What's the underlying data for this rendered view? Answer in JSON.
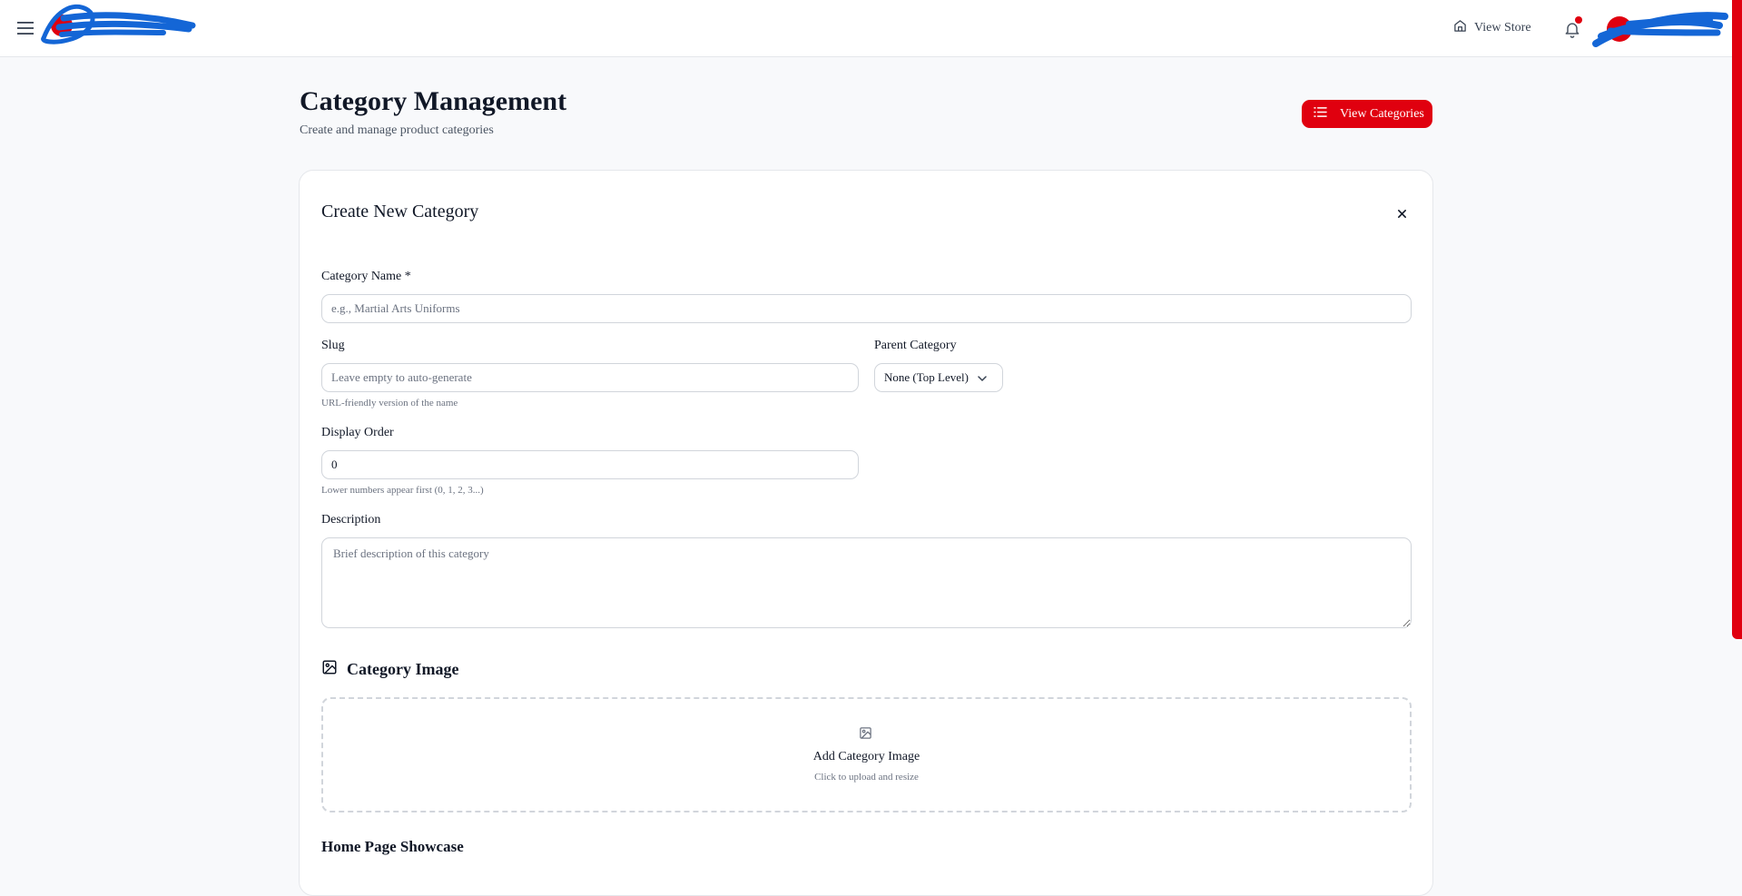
{
  "header": {
    "menu_icon": "hamburger-menu-icon",
    "logo_icon": "brand-logo-redacted",
    "view_store_label": "View Store",
    "view_store_icon": "home-icon",
    "bell_icon": "bell-icon",
    "avatar_icon": "user-avatar-redacted",
    "accent_color": "#e0000f"
  },
  "page": {
    "title": "Category Management",
    "subtitle": "Create and manage product categories",
    "view_categories_label": "View Categories",
    "view_categories_icon": "list-icon"
  },
  "form": {
    "title": "Create New Category",
    "close_icon": "close-icon",
    "name": {
      "label": "Category Name *",
      "placeholder": "e.g., Martial Arts Uniforms",
      "value": ""
    },
    "slug": {
      "label": "Slug",
      "placeholder": "Leave empty to auto-generate",
      "value": "",
      "hint": "URL-friendly version of the name"
    },
    "parent": {
      "label": "Parent Category",
      "selected": "None (Top Level)"
    },
    "display_order": {
      "label": "Display Order",
      "value": "0",
      "hint": "Lower numbers appear first (0, 1, 2, 3...)"
    },
    "description": {
      "label": "Description",
      "placeholder": "Brief description of this category",
      "value": ""
    },
    "image_section": {
      "heading": "Category Image",
      "icon": "image-icon",
      "upload_title": "Add Category Image",
      "upload_subtitle": "Click to upload and resize"
    },
    "showcase_heading": "Home Page Showcase"
  }
}
